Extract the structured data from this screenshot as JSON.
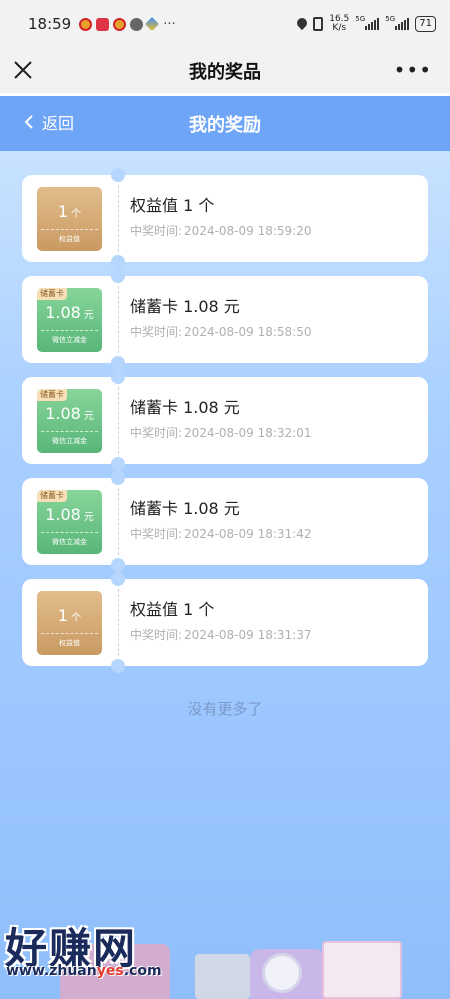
{
  "status_bar": {
    "time": "18:59",
    "more": "···",
    "net_speed_value": "16.5",
    "net_speed_unit": "K/s",
    "sig1_tag": "5G",
    "sig2_tag": "5G",
    "battery": "71"
  },
  "title_bar": {
    "title": "我的奖品",
    "more_label": "•••"
  },
  "header": {
    "back_label": "返回",
    "title": "我的奖励"
  },
  "prizes": [
    {
      "coupon_style": "gold",
      "coupon_tag": "",
      "coupon_value": "1",
      "coupon_unit": "个",
      "coupon_sub": "权益值",
      "title": "权益值 1 个",
      "time_label": "中奖时间:",
      "time_value": "2024-08-09 18:59:20"
    },
    {
      "coupon_style": "green",
      "coupon_tag": "储蓄卡",
      "coupon_value": "1.08",
      "coupon_unit": "元",
      "coupon_sub": "微信立减金",
      "title": "储蓄卡 1.08 元",
      "time_label": "中奖时间:",
      "time_value": "2024-08-09 18:58:50"
    },
    {
      "coupon_style": "green",
      "coupon_tag": "储蓄卡",
      "coupon_value": "1.08",
      "coupon_unit": "元",
      "coupon_sub": "微信立减金",
      "title": "储蓄卡 1.08 元",
      "time_label": "中奖时间:",
      "time_value": "2024-08-09 18:32:01"
    },
    {
      "coupon_style": "green",
      "coupon_tag": "储蓄卡",
      "coupon_value": "1.08",
      "coupon_unit": "元",
      "coupon_sub": "微信立减金",
      "title": "储蓄卡 1.08 元",
      "time_label": "中奖时间:",
      "time_value": "2024-08-09 18:31:42"
    },
    {
      "coupon_style": "gold",
      "coupon_tag": "",
      "coupon_value": "1",
      "coupon_unit": "个",
      "coupon_sub": "权益值",
      "title": "权益值 1 个",
      "time_label": "中奖时间:",
      "time_value": "2024-08-09 18:31:37"
    }
  ],
  "footer": {
    "no_more": "没有更多了"
  },
  "watermark": {
    "brand": "好赚网",
    "url_prefix": "www.zhuan",
    "url_highlight": "yes",
    "url_suffix": ".com"
  },
  "colors": {
    "header_bg": "#6fa5f7",
    "gold_coupon": "#d3a873",
    "green_coupon": "#6cc487"
  }
}
